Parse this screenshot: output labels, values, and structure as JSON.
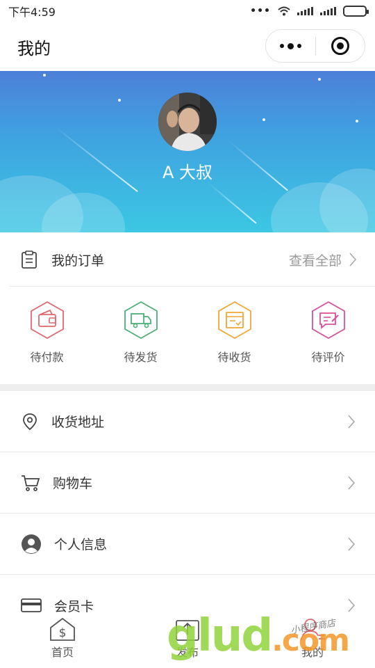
{
  "status_bar": {
    "time": "下午4:59",
    "dots": "•••"
  },
  "nav": {
    "title": "我的"
  },
  "profile": {
    "username": "A 大叔"
  },
  "orders": {
    "title": "我的订单",
    "view_all": "查看全部",
    "items": [
      {
        "label": "待付款",
        "icon": "wallet-icon",
        "color": "#e0666e"
      },
      {
        "label": "待发货",
        "icon": "truck-icon",
        "color": "#4caf78"
      },
      {
        "label": "待收货",
        "icon": "package-icon",
        "color": "#f0a638"
      },
      {
        "label": "待评价",
        "icon": "review-icon",
        "color": "#d9509a"
      }
    ]
  },
  "menu": [
    {
      "label": "收货地址",
      "icon": "location-pin-icon"
    },
    {
      "label": "购物车",
      "icon": "shopping-cart-icon"
    },
    {
      "label": "个人信息",
      "icon": "user-circle-icon"
    },
    {
      "label": "会员卡",
      "icon": "card-icon"
    }
  ],
  "tab_bar": {
    "items": [
      {
        "label": "首页",
        "icon": "home-icon"
      },
      {
        "label": "发布",
        "icon": "upload-icon"
      },
      {
        "label": "我的",
        "icon": "profile-icon"
      }
    ]
  },
  "watermark": {
    "brand": "glud",
    "suffix": ".com",
    "small": "小程序商店"
  },
  "colors": {
    "banner_top": "#4d7fd8",
    "banner_bottom": "#3cc7e3",
    "divider": "#e6e6e6"
  }
}
